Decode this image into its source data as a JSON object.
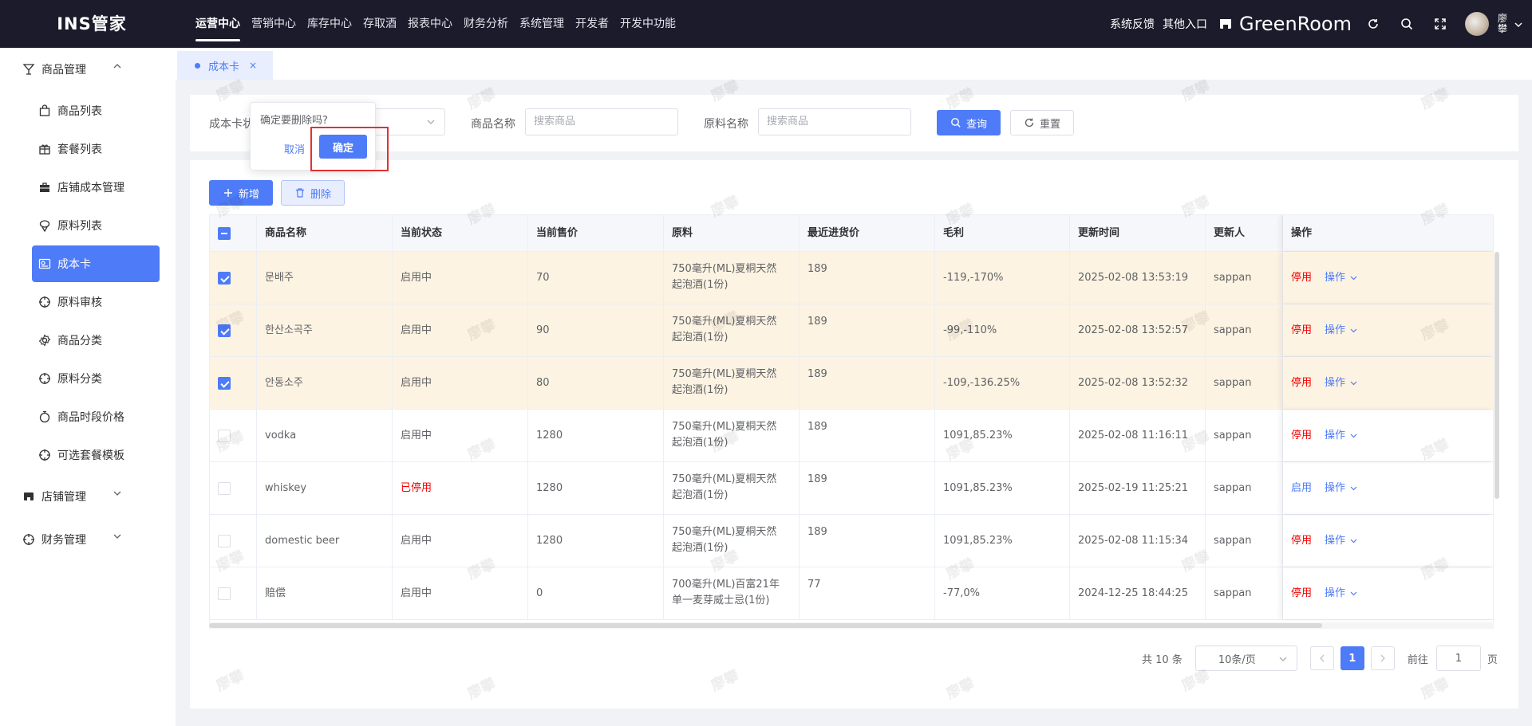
{
  "app": {
    "logo": "INS管家"
  },
  "topnav": [
    {
      "label": "运营中心",
      "active": true
    },
    {
      "label": "营销中心"
    },
    {
      "label": "库存中心"
    },
    {
      "label": "存取酒"
    },
    {
      "label": "报表中心"
    },
    {
      "label": "财务分析"
    },
    {
      "label": "系统管理"
    },
    {
      "label": "开发者"
    },
    {
      "label": "开发中功能"
    }
  ],
  "topright": {
    "feedback": "系统反馈",
    "other_entry": "其他入口",
    "store_name": "GreenRoom",
    "username": "廖攀"
  },
  "sidebar": {
    "group_product": "商品管理",
    "items": [
      {
        "label": "商品列表",
        "icon": "bag-icon"
      },
      {
        "label": "套餐列表",
        "icon": "gift-icon"
      },
      {
        "label": "店铺成本管理",
        "icon": "briefcase-icon"
      },
      {
        "label": "原料列表",
        "icon": "ingredient-icon"
      },
      {
        "label": "成本卡",
        "icon": "card-icon",
        "active": true
      },
      {
        "label": "原料审核",
        "icon": "target-icon"
      },
      {
        "label": "商品分类",
        "icon": "settings-icon"
      },
      {
        "label": "原料分类",
        "icon": "target-icon"
      },
      {
        "label": "商品时段价格",
        "icon": "timer-icon"
      },
      {
        "label": "可选套餐模板",
        "icon": "target-icon"
      }
    ],
    "group_store": "店铺管理",
    "group_finance": "财务管理"
  },
  "tab": {
    "label": "成本卡",
    "close": "×"
  },
  "filter": {
    "card_label": "成本卡状",
    "product_label": "商品名称",
    "product_placeholder": "搜索商品",
    "material_label": "原料名称",
    "material_placeholder": "搜索商品",
    "query": "查询",
    "reset": "重置"
  },
  "popconfirm": {
    "message": "确定要删除吗?",
    "cancel": "取消",
    "confirm": "确定"
  },
  "toolbar": {
    "add": "新增",
    "delete": "删除"
  },
  "table": {
    "headers": [
      "商品名称",
      "当前状态",
      "当前售价",
      "原料",
      "最近进货价",
      "毛利",
      "更新时间",
      "更新人",
      "操作"
    ],
    "rows": [
      {
        "checked": true,
        "name": "문배주",
        "status": "启用中",
        "price": "70",
        "material_1": "750毫升(ML)夏桐天然",
        "material_2": "起泡酒(1份)",
        "cost": "189",
        "profit": "-119,-170%",
        "time": "2025-02-08 13:53:19",
        "user": "sappan",
        "toggle": "停用",
        "op": "操作"
      },
      {
        "checked": true,
        "name": "한산소곡주",
        "status": "启用中",
        "price": "90",
        "material_1": "750毫升(ML)夏桐天然",
        "material_2": "起泡酒(1份)",
        "cost": "189",
        "profit": "-99,-110%",
        "time": "2025-02-08 13:52:57",
        "user": "sappan",
        "toggle": "停用",
        "op": "操作"
      },
      {
        "checked": true,
        "name": "안동소주",
        "status": "启用中",
        "price": "80",
        "material_1": "750毫升(ML)夏桐天然",
        "material_2": "起泡酒(1份)",
        "cost": "189",
        "profit": "-109,-136.25%",
        "time": "2025-02-08 13:52:32",
        "user": "sappan",
        "toggle": "停用",
        "op": "操作"
      },
      {
        "checked": false,
        "name": "vodka",
        "status": "启用中",
        "price": "1280",
        "material_1": "750毫升(ML)夏桐天然",
        "material_2": "起泡酒(1份)",
        "cost": "189",
        "profit": "1091,85.23%",
        "time": "2025-02-08 11:16:11",
        "user": "sappan",
        "toggle": "停用",
        "op": "操作"
      },
      {
        "checked": false,
        "name": "whiskey",
        "status": "已停用",
        "price": "1280",
        "material_1": "750毫升(ML)夏桐天然",
        "material_2": "起泡酒(1份)",
        "cost": "189",
        "profit": "1091,85.23%",
        "time": "2025-02-19 11:25:21",
        "user": "sappan",
        "toggle": "启用",
        "op": "操作"
      },
      {
        "checked": false,
        "name": "domestic beer",
        "status": "启用中",
        "price": "1280",
        "material_1": "750毫升(ML)夏桐天然",
        "material_2": "起泡酒(1份)",
        "cost": "189",
        "profit": "1091,85.23%",
        "time": "2025-02-08 11:15:34",
        "user": "sappan",
        "toggle": "停用",
        "op": "操作"
      },
      {
        "checked": false,
        "name": "赔偿",
        "status": "启用中",
        "price": "0",
        "material_1": "700毫升(ML)百富21年",
        "material_2": "单一麦芽威士忌(1份)",
        "cost": "77",
        "profit": "-77,0%",
        "time": "2024-12-25 18:44:25",
        "user": "sappan",
        "toggle": "停用",
        "op": "操作"
      }
    ]
  },
  "pagination": {
    "total": "共 10 条",
    "page_size": "10条/页",
    "current": "1",
    "goto_label": "前往",
    "goto_value": "1",
    "page_unit": "页"
  },
  "watermark": "廖攀",
  "colors": {
    "primary": "#4e7bf7",
    "topbar": "#1b1b2b",
    "selected_row": "#fdf3e2",
    "danger": "#f56c6c",
    "highlight_box": "#e43030"
  }
}
